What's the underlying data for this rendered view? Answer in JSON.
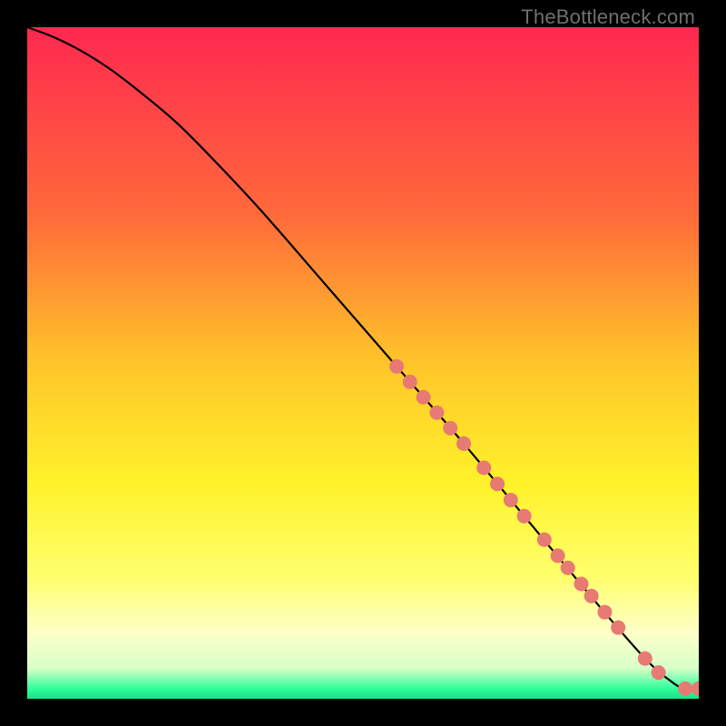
{
  "watermark": "TheBottleneck.com",
  "colors": {
    "page_bg": "#000000",
    "curve": "#000000",
    "marker": "#e77a72",
    "gradient_stops": [
      {
        "offset": 0.0,
        "color": "#ff2850"
      },
      {
        "offset": 0.28,
        "color": "#ff6a3a"
      },
      {
        "offset": 0.5,
        "color": "#ffc52a"
      },
      {
        "offset": 0.68,
        "color": "#fff22a"
      },
      {
        "offset": 0.82,
        "color": "#ffff6e"
      },
      {
        "offset": 0.9,
        "color": "#ffffc8"
      },
      {
        "offset": 0.955,
        "color": "#d8ffc8"
      },
      {
        "offset": 0.985,
        "color": "#2fff9c"
      },
      {
        "offset": 1.0,
        "color": "#18e08a"
      }
    ]
  },
  "chart_data": {
    "type": "line",
    "title": "",
    "xlabel": "",
    "ylabel": "",
    "xlim": [
      0,
      100
    ],
    "ylim": [
      0,
      100
    ],
    "curve": {
      "x": [
        0,
        4,
        8,
        12,
        16,
        22,
        28,
        35,
        45,
        55,
        65,
        75,
        85,
        92,
        96,
        98,
        100
      ],
      "y": [
        100,
        98.5,
        96.5,
        94,
        91,
        86,
        80,
        72.5,
        61,
        49.5,
        38,
        26,
        14,
        6,
        2.5,
        1.5,
        1.5
      ]
    },
    "markers": [
      {
        "x": 55,
        "y": 49.5
      },
      {
        "x": 57,
        "y": 47.2
      },
      {
        "x": 59,
        "y": 44.9
      },
      {
        "x": 61,
        "y": 42.6
      },
      {
        "x": 63,
        "y": 40.3
      },
      {
        "x": 65,
        "y": 38.0
      },
      {
        "x": 68,
        "y": 34.4
      },
      {
        "x": 70,
        "y": 32.0
      },
      {
        "x": 72,
        "y": 29.6
      },
      {
        "x": 74,
        "y": 27.2
      },
      {
        "x": 77,
        "y": 23.7
      },
      {
        "x": 79,
        "y": 21.3
      },
      {
        "x": 80.5,
        "y": 19.5
      },
      {
        "x": 82.5,
        "y": 17.1
      },
      {
        "x": 84,
        "y": 15.3
      },
      {
        "x": 86,
        "y": 12.9
      },
      {
        "x": 88,
        "y": 10.6
      },
      {
        "x": 92,
        "y": 6.0
      },
      {
        "x": 94,
        "y": 3.9
      },
      {
        "x": 98,
        "y": 1.5
      },
      {
        "x": 100,
        "y": 1.5
      }
    ]
  }
}
